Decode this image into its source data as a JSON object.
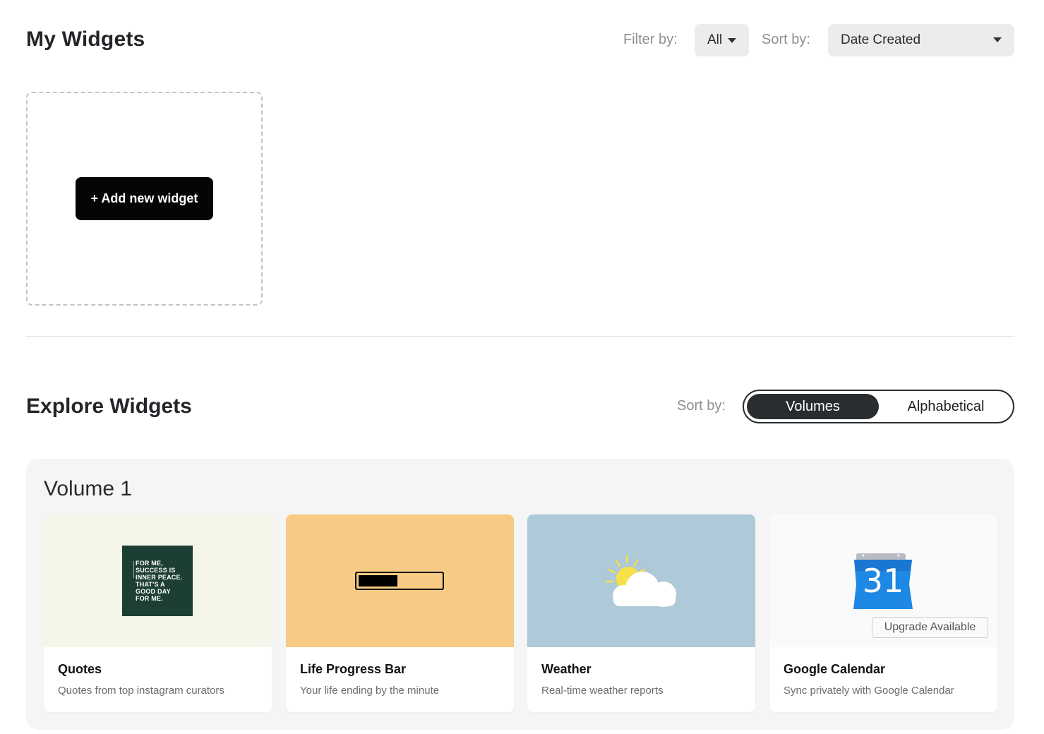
{
  "my_widgets": {
    "title": "My Widgets",
    "filter_label": "Filter by:",
    "filter_value": "All",
    "sort_label": "Sort by:",
    "sort_value": "Date Created",
    "add_button_label": "+ Add new widget"
  },
  "explore": {
    "title": "Explore Widgets",
    "sort_label": "Sort by:",
    "sort_options": [
      "Volumes",
      "Alphabetical"
    ],
    "sort_selected": "Volumes"
  },
  "volumes": [
    {
      "title": "Volume 1",
      "widgets": [
        {
          "title": "Quotes",
          "description": "Quotes from top instagram curators",
          "thumb_color": "#f5f5ea",
          "icon": "quote-image",
          "quote_lines": [
            "FOR ME,",
            "SUCCESS IS",
            "INNER PEACE.",
            "THAT'S A",
            "GOOD DAY",
            "FOR ME."
          ]
        },
        {
          "title": "Life Progress Bar",
          "description": "Your life ending by the minute",
          "thumb_color": "#f7cb84",
          "icon": "progress-bar-icon",
          "progress_fraction": 0.47
        },
        {
          "title": "Weather",
          "description": "Real-time weather reports",
          "thumb_color": "#aec9d7",
          "icon": "sun-cloud-icon"
        },
        {
          "title": "Google Calendar",
          "description": "Sync privately with Google Calendar",
          "thumb_color": "#fafafa",
          "icon": "google-calendar-icon",
          "calendar_day": "31",
          "badge": "Upgrade Available"
        }
      ]
    }
  ],
  "colors": {
    "primary_dark": "#2a2d30",
    "button_black": "#050505",
    "calendar_blue": "#1e88e5",
    "muted_text": "#8f8f8f"
  }
}
